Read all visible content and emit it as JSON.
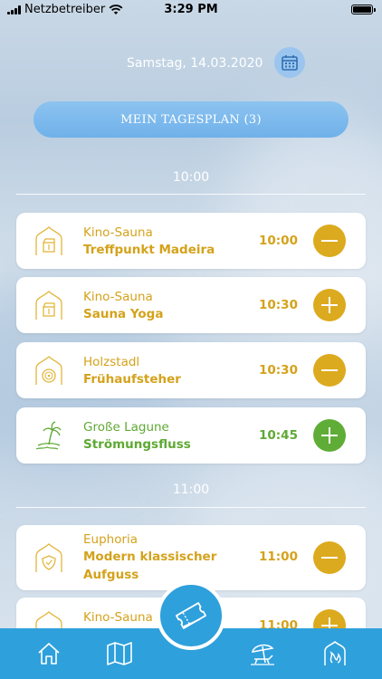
{
  "status_bar": {
    "carrier": "Netzbetreiber",
    "time": "3:29 PM"
  },
  "header": {
    "date": "Samstag, 14.03.2020"
  },
  "plan_button": {
    "label": "MEIN TAGESPLAN (3)"
  },
  "sections": [
    {
      "time": "10:00",
      "items": [
        {
          "location": "Kino-Sauna",
          "title": "Treffpunkt Madeira",
          "time": "10:00",
          "icon": "sauna-cinema-icon",
          "action": "remove"
        },
        {
          "location": "Kino-Sauna",
          "title": "Sauna Yoga",
          "time": "10:30",
          "icon": "sauna-cinema-icon",
          "action": "add"
        },
        {
          "location": "Holzstadl",
          "title": "Frühaufsteher",
          "time": "10:30",
          "icon": "sauna-wood-icon",
          "action": "remove"
        },
        {
          "location": "Große Lagune",
          "title": "Strömungsfluss",
          "time": "10:45",
          "icon": "lagoon-palm-icon",
          "action": "add"
        }
      ]
    },
    {
      "time": "11:00",
      "items": [
        {
          "location": "Euphoria",
          "title": "Modern klassischer Aufguss",
          "title_line1": "Modern klassischer",
          "title_line2": "Aufguss",
          "time": "11:00",
          "icon": "sauna-shield-icon",
          "action": "remove"
        },
        {
          "location": "Kino-Sauna",
          "title": "",
          "time": "11:00",
          "icon": "sauna-cinema-icon",
          "action": "add"
        }
      ]
    }
  ],
  "tabbar": {
    "tabs": [
      "home-icon",
      "map-icon",
      "tickets-icon",
      "beach-icon",
      "sauna-icon"
    ]
  },
  "colors": {
    "accent_yellow": "#dcaa1e",
    "accent_green": "#5fad37",
    "tab_blue": "#2ea0dc",
    "plan_blue": "#7ab8ec"
  }
}
